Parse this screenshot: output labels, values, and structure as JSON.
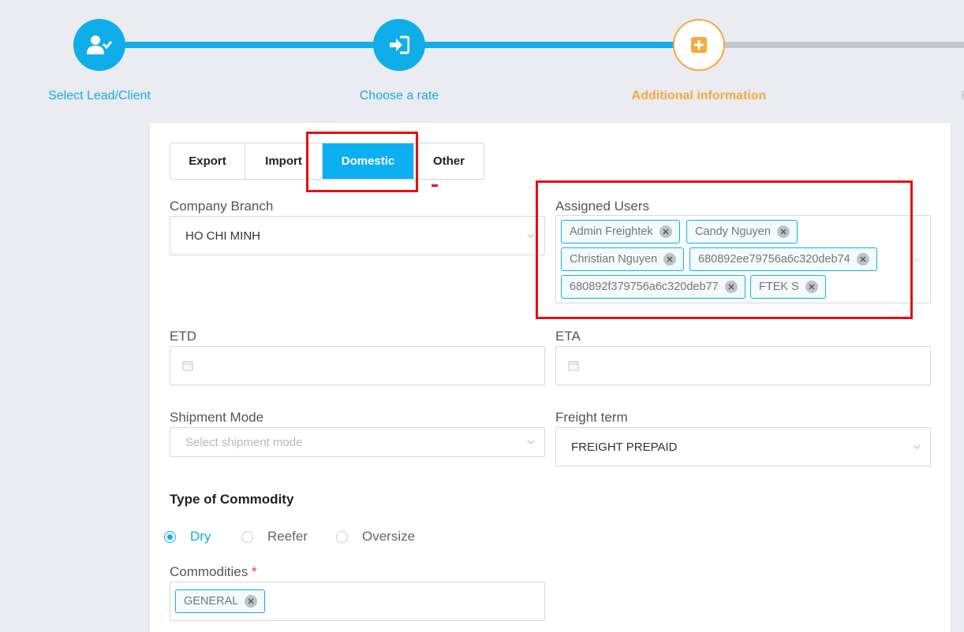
{
  "stepper": {
    "steps": [
      {
        "label": "Select Lead/Client",
        "icon": "user-check-icon",
        "state": "done"
      },
      {
        "label": "Choose a rate",
        "icon": "sign-in-icon",
        "state": "done"
      },
      {
        "label": "Additional information",
        "icon": "plus-square-icon",
        "state": "current"
      },
      {
        "label": "R",
        "state": "next"
      }
    ],
    "colors": {
      "done": "#10aee8",
      "current": "#f7a93a",
      "inactive": "#c4c7cf"
    }
  },
  "tabs": [
    {
      "label": "Export"
    },
    {
      "label": "Import"
    },
    {
      "label": "Domestic",
      "active": true
    },
    {
      "label": "Other"
    }
  ],
  "company_branch": {
    "label": "Company Branch",
    "value": "HO CHI MINH"
  },
  "assigned_users": {
    "label": "Assigned Users",
    "tags": [
      "Admin Freightek",
      "Candy Nguyen",
      "Christian Nguyen",
      "680892ee79756a6c320deb74",
      "680892f379756a6c320deb77",
      "FTEK S"
    ]
  },
  "etd": {
    "label": "ETD"
  },
  "eta": {
    "label": "ETA"
  },
  "shipment_mode": {
    "label": "Shipment Mode",
    "placeholder": "Select shipment mode"
  },
  "freight_term": {
    "label": "Freight term",
    "value": "FREIGHT PREPAID"
  },
  "commodity_type": {
    "title": "Type of Commodity",
    "options": [
      {
        "label": "Dry",
        "checked": true
      },
      {
        "label": "Reefer",
        "checked": false
      },
      {
        "label": "Oversize",
        "checked": false
      }
    ]
  },
  "commodities": {
    "label": "Commodities",
    "required_mark": "*",
    "tags": [
      "GENERAL"
    ]
  },
  "colors": {
    "accent": "#0cb0f0",
    "annotation": "#e60f0f",
    "background": "#ebebf2"
  }
}
